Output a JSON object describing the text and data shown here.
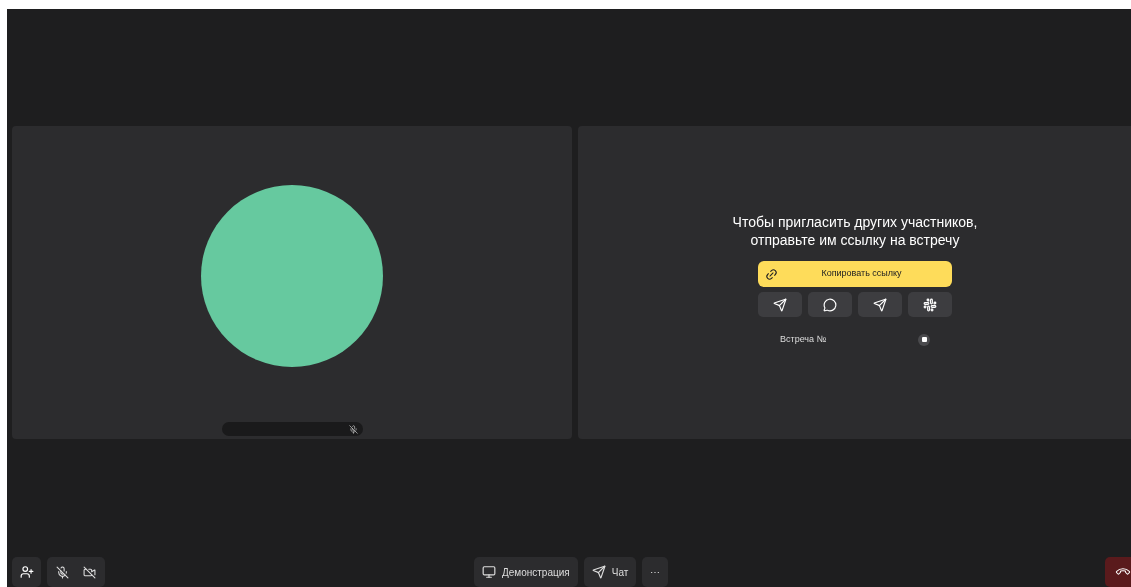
{
  "invite": {
    "title": "Чтобы пригласить других участников, отправьте им ссылку на встречу",
    "copy_button": "Копировать ссылку",
    "share_buttons": [
      {
        "kind": "telegram"
      },
      {
        "kind": "whatsapp"
      },
      {
        "kind": "send"
      },
      {
        "kind": "slack"
      }
    ],
    "meeting_label": "Встреча №"
  },
  "self_tile": {
    "mic_muted": true
  },
  "toolbar": {
    "mic_muted": true,
    "camera_off": true,
    "center": [
      {
        "kind": "screen",
        "label": "Демонстрация"
      },
      {
        "kind": "chat",
        "label": "Чат"
      },
      {
        "kind": "more",
        "label": "⋯"
      }
    ]
  }
}
